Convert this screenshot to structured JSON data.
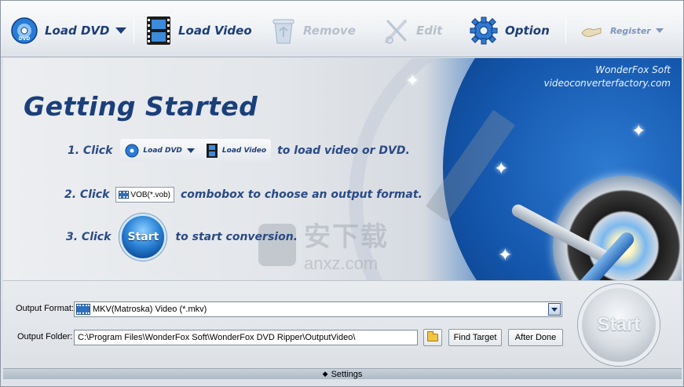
{
  "toolbar": {
    "load_dvd": "Load DVD",
    "load_video": "Load Video",
    "remove": "Remove",
    "edit": "Edit",
    "option": "Option",
    "register": "Register"
  },
  "banner": {
    "brand_name": "WonderFox Soft",
    "brand_url": "videoconverterfactory.com",
    "title": "Getting Started",
    "step1": {
      "prefix": "1. Click",
      "chip1": "Load DVD",
      "chip2": "Load Video",
      "suffix": "to load video or DVD."
    },
    "step2": {
      "prefix": "2. Click",
      "combo": "VOB(*.vob)",
      "suffix": "combobox to choose an output format."
    },
    "step3": {
      "prefix": "3. Click",
      "button": "Start",
      "suffix": "to start conversion."
    },
    "watermark_cn": "安下载",
    "watermark_en": "anxz.com"
  },
  "output": {
    "format_label": "Output Format:",
    "format_value": "MKV(Matroska) Video (*.mkv)",
    "folder_label": "Output Folder:",
    "folder_value": "C:\\Program Files\\WonderFox Soft\\WonderFox DVD Ripper\\OutputVideo\\",
    "find_target": "Find Target",
    "after_done": "After Done",
    "start": "Start"
  },
  "settings_bar": {
    "label": "Settings"
  },
  "colors": {
    "accent": "#1e3e78",
    "banner_blue": "#0f4c9c",
    "disabled": "#b6c0cb"
  }
}
